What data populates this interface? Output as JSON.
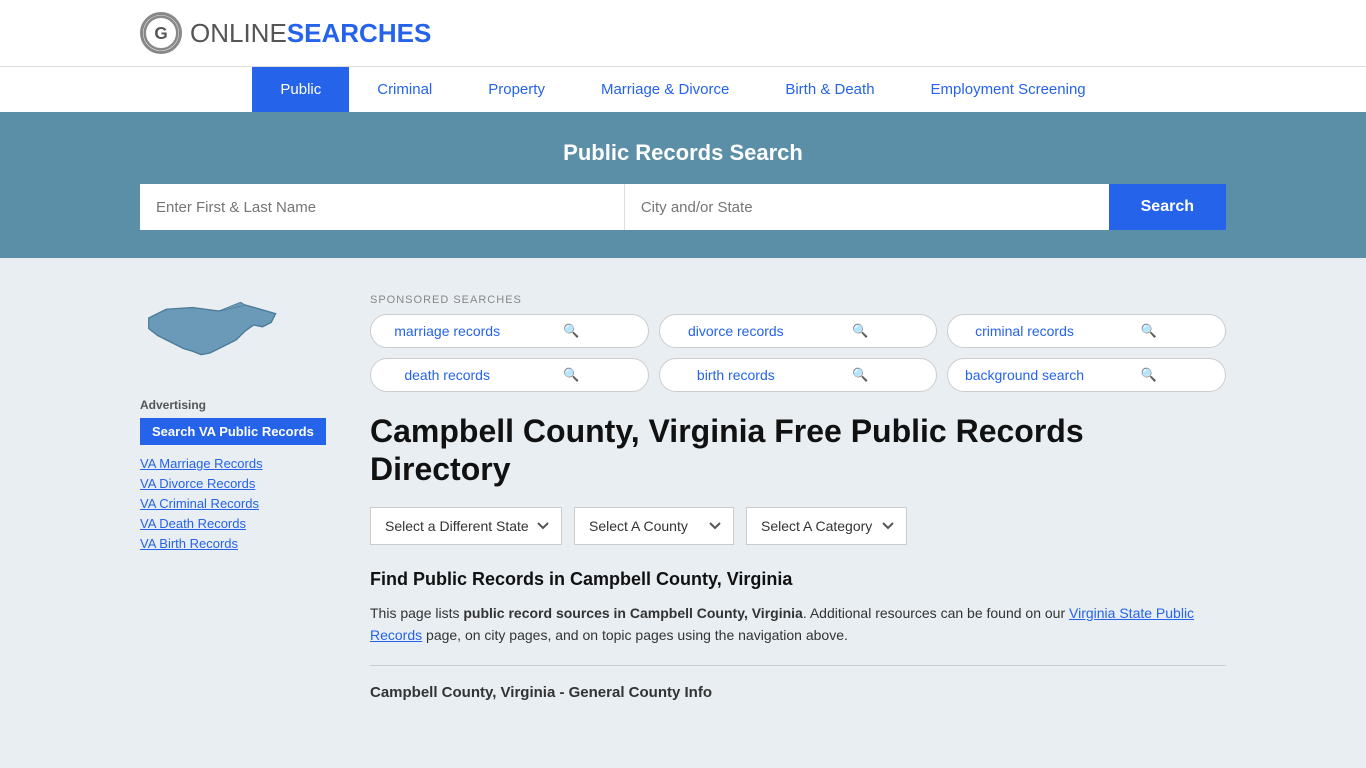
{
  "header": {
    "logo_symbol": "G",
    "logo_text_normal": "ONLINE",
    "logo_text_bold": "SEARCHES"
  },
  "nav": {
    "items": [
      {
        "label": "Public",
        "active": true
      },
      {
        "label": "Criminal",
        "active": false
      },
      {
        "label": "Property",
        "active": false
      },
      {
        "label": "Marriage & Divorce",
        "active": false
      },
      {
        "label": "Birth & Death",
        "active": false
      },
      {
        "label": "Employment Screening",
        "active": false
      }
    ]
  },
  "search_banner": {
    "title": "Public Records Search",
    "name_placeholder": "Enter First & Last Name",
    "location_placeholder": "City and/or State",
    "button_label": "Search"
  },
  "sponsored": {
    "label": "SPONSORED SEARCHES",
    "pills": [
      {
        "label": "marriage records"
      },
      {
        "label": "divorce records"
      },
      {
        "label": "criminal records"
      },
      {
        "label": "death records"
      },
      {
        "label": "birth records"
      },
      {
        "label": "background search"
      }
    ]
  },
  "page": {
    "title": "Campbell County, Virginia Free Public Records Directory",
    "dropdowns": {
      "state_label": "Select a Different State",
      "county_label": "Select A County",
      "category_label": "Select A Category"
    },
    "find_heading": "Find Public Records in Campbell County, Virginia",
    "find_text_1": "This page lists ",
    "find_text_bold": "public record sources in Campbell County, Virginia",
    "find_text_2": ". Additional resources can be found on our ",
    "find_link": "Virginia State Public Records",
    "find_text_3": " page, on city pages, and on topic pages using the navigation above.",
    "county_info_label": "Campbell County, Virginia - General County Info"
  },
  "sidebar": {
    "advertising_label": "Advertising",
    "btn_label": "Search VA Public Records",
    "links": [
      {
        "label": "VA Marriage Records"
      },
      {
        "label": "VA Divorce Records"
      },
      {
        "label": "VA Criminal Records"
      },
      {
        "label": "VA Death Records"
      },
      {
        "label": "VA Birth Records"
      }
    ]
  }
}
